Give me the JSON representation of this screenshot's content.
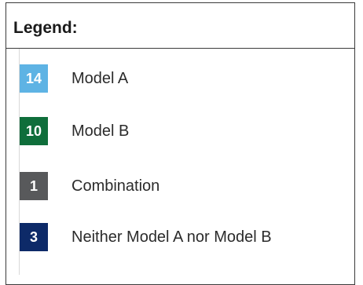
{
  "legend": {
    "title": "Legend:",
    "items": [
      {
        "count": "14",
        "label": "Model A",
        "color": "#5eb3e4"
      },
      {
        "count": "10",
        "label": "Model B",
        "color": "#0f6e3b"
      },
      {
        "count": "1",
        "label": "Combination",
        "color": "#58595b"
      },
      {
        "count": "3",
        "label": "Neither Model A nor Model B",
        "color": "#0d2a68"
      }
    ]
  }
}
